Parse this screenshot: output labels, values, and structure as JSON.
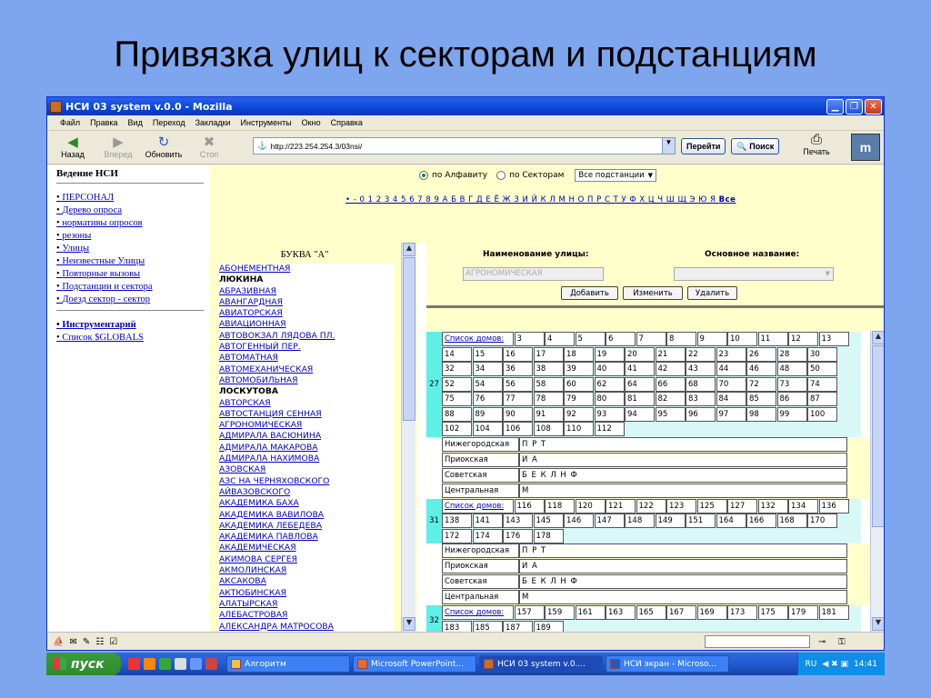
{
  "slide_title": "Привязка улиц к секторам и подстанциям",
  "window": {
    "title": "НСИ 03 system v.0.0 - Mozilla",
    "menu": [
      "Файл",
      "Правка",
      "Вид",
      "Переход",
      "Закладки",
      "Инструменты",
      "Окно",
      "Справка"
    ],
    "toolbar": {
      "back": "Назад",
      "forward": "Вперед",
      "reload": "Обновить",
      "stop": "Стоп",
      "go": "Перейти",
      "search": "Поиск",
      "print": "Печать"
    },
    "url": "http://223.254.254.3/03nsi/"
  },
  "leftnav": {
    "heading": "Ведение НСИ",
    "items": [
      "ПЕРСОНАЛ",
      "Дерево опроса",
      "нормативы опросов",
      "резоны",
      "Улицы",
      "Неизвестные Улицы",
      "Повторные вызовы",
      "Подстанции и сектора",
      "Доезд сектор - сектор"
    ],
    "tools": [
      "Инструментарий",
      "Список $GLOBALS"
    ]
  },
  "filter": {
    "radio_alpha": "по Алфавиту",
    "radio_sector": "по Секторам",
    "select_value": "Все подстанции",
    "alphabet": "• - 0 1 2 3 4 5 6 7 8 9 А Б В Г Д Е Ё Ж З И Й К Л М Н О П Р С Т У Ф Х Ц Ч Ш Щ Э Ю Я",
    "all_link": "Все"
  },
  "streets": {
    "heading": "БУКВА \"А\"",
    "items": [
      {
        "t": "АБОНЕМЕНТНАЯ",
        "k": "lnk"
      },
      {
        "t": "ЛЮКИНА",
        "k": "bold"
      },
      {
        "t": "АБРАЗИВНАЯ",
        "k": "lnk"
      },
      {
        "t": "АВАНГАРДНАЯ",
        "k": "lnk"
      },
      {
        "t": "АВИАТОРСКАЯ",
        "k": "lnk"
      },
      {
        "t": "АВИАЦИОННАЯ",
        "k": "lnk"
      },
      {
        "t": "АВТОВОКЗАЛ ЛЯДОВА ПЛ.",
        "k": "lnk"
      },
      {
        "t": "АВТОГЕННЫЙ ПЕР.",
        "k": "lnk"
      },
      {
        "t": "АВТОМАТНАЯ",
        "k": "lnk"
      },
      {
        "t": "АВТОМЕХАНИЧЕСКАЯ",
        "k": "lnk"
      },
      {
        "t": "АВТОМОБИЛЬНАЯ",
        "k": "lnk"
      },
      {
        "t": "ЛОСКУТОВА",
        "k": "bold"
      },
      {
        "t": "АВТОРСКАЯ",
        "k": "lnk"
      },
      {
        "t": "АВТОСТАНЦИЯ СЕННАЯ",
        "k": "lnk"
      },
      {
        "t": "АГРОНОМИЧЕСКАЯ",
        "k": "lnk"
      },
      {
        "t": "АДМИРАЛА ВАСЮНИНА",
        "k": "lnk"
      },
      {
        "t": "АДМИРАЛА МАКАРОВА",
        "k": "lnk"
      },
      {
        "t": "АДМИРАЛА НАХИМОВА",
        "k": "lnk"
      },
      {
        "t": "АЗОВСКАЯ",
        "k": "lnk"
      },
      {
        "t": "АЗС НА ЧЕРНЯХОВСКОГО",
        "k": "lnk"
      },
      {
        "t": "АЙВАЗОВСКОГО",
        "k": "lnk"
      },
      {
        "t": "АКАДЕМИКА БАХА",
        "k": "lnk"
      },
      {
        "t": "АКАДЕМИКА ВАВИЛОВА",
        "k": "lnk"
      },
      {
        "t": "АКАДЕМИКА ЛЕБЕДЕВА",
        "k": "lnk"
      },
      {
        "t": "АКАДЕМИКА ПАВЛОВА",
        "k": "lnk"
      },
      {
        "t": "АКАДЕМИЧЕСКАЯ",
        "k": "lnk"
      },
      {
        "t": "АКИМОВА СЕРГЕЯ",
        "k": "lnk"
      },
      {
        "t": "АКМОЛИНСКАЯ",
        "k": "lnk"
      },
      {
        "t": "АКСАКОВА",
        "k": "lnk"
      },
      {
        "t": "АКТЮБИНСКАЯ",
        "k": "lnk"
      },
      {
        "t": "АЛАТЫРСКАЯ",
        "k": "lnk"
      },
      {
        "t": "АЛЕБАСТРОВАЯ",
        "k": "lnk"
      },
      {
        "t": "АЛЕКСАНДРА МАТРОСОВА",
        "k": "lnk"
      }
    ]
  },
  "form": {
    "street_label": "Наименование улицы:",
    "main_label": "Основное название:",
    "street_value": "АГРОНОМИЧЕСКАЯ",
    "add": "Добавить",
    "edit": "Изменить",
    "delete": "Удалить"
  },
  "blocks": [
    {
      "num": "27",
      "link": "Список домов:",
      "rows": [
        [
          "3",
          "4",
          "5",
          "6",
          "7",
          "8",
          "9",
          "10",
          "11",
          "12",
          "13"
        ],
        [
          "14",
          "15",
          "16",
          "17",
          "18",
          "19",
          "20",
          "21",
          "22",
          "23",
          "26",
          "28",
          "30"
        ],
        [
          "32",
          "34",
          "36",
          "38",
          "39",
          "40",
          "41",
          "42",
          "43",
          "44",
          "46",
          "48",
          "50"
        ],
        [
          "52",
          "54",
          "56",
          "58",
          "60",
          "62",
          "64",
          "66",
          "68",
          "70",
          "72",
          "73",
          "74"
        ],
        [
          "75",
          "76",
          "77",
          "78",
          "79",
          "80",
          "81",
          "82",
          "83",
          "84",
          "85",
          "86",
          "87"
        ],
        [
          "88",
          "89",
          "90",
          "91",
          "92",
          "93",
          "94",
          "95",
          "96",
          "97",
          "98",
          "99",
          "100"
        ],
        [
          "102",
          "104",
          "106",
          "108",
          "110",
          "112"
        ]
      ],
      "sectors": [
        [
          "Нижегородская",
          "П Р Т"
        ],
        [
          "Приокская",
          "И А"
        ],
        [
          "Советская",
          "Б Е К Л Н Ф"
        ],
        [
          "Центральная",
          "М"
        ]
      ]
    },
    {
      "num": "31",
      "link": "Список домов:",
      "rows": [
        [
          "116",
          "118",
          "120",
          "121",
          "122",
          "123",
          "125",
          "127",
          "132",
          "134",
          "136"
        ],
        [
          "138",
          "141",
          "143",
          "145",
          "146",
          "147",
          "148",
          "149",
          "151",
          "164",
          "166",
          "168",
          "170"
        ],
        [
          "172",
          "174",
          "176",
          "178"
        ]
      ],
      "sectors": [
        [
          "Нижегородская",
          "П Р Т"
        ],
        [
          "Приокская",
          "И А"
        ],
        [
          "Советская",
          "Б Е К Л Н Ф"
        ],
        [
          "Центральная",
          "М"
        ]
      ]
    },
    {
      "num": "32",
      "link": "Список домов:",
      "rows": [
        [
          "157",
          "159",
          "161",
          "163",
          "165",
          "167",
          "169",
          "173",
          "175",
          "179",
          "181"
        ],
        [
          "183",
          "185",
          "187",
          "189"
        ]
      ],
      "sectors": []
    }
  ],
  "taskbar": {
    "start": "пуск",
    "tasks": [
      "Алгоритм",
      "Microsoft PowerPoint...",
      "НСИ 03 system v.0....",
      "НСИ экран - Microso..."
    ],
    "lang": "RU",
    "time": "14:41"
  }
}
